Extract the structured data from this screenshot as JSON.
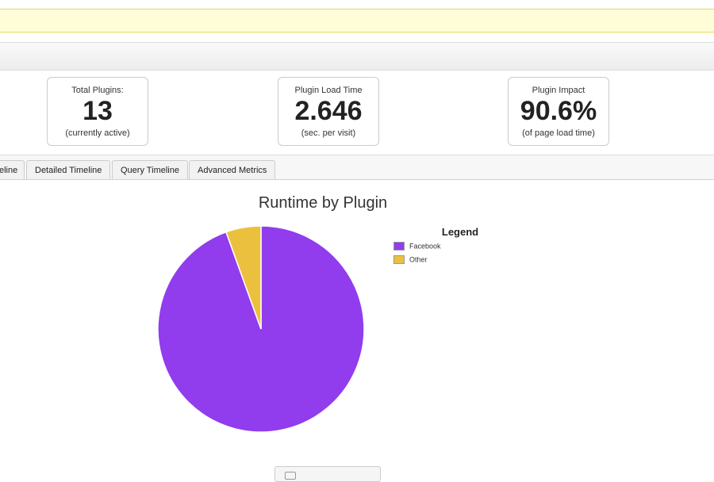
{
  "stats": [
    {
      "label": "Total Plugins:",
      "value": "13",
      "sub": "(currently active)"
    },
    {
      "label": "Plugin Load Time",
      "value": "2.646",
      "sub": "(sec. per visit)"
    },
    {
      "label": "Plugin Impact",
      "value": "90.6%",
      "sub": "(of page load time)"
    }
  ],
  "tabs": [
    "eline",
    "Detailed Timeline",
    "Query Timeline",
    "Advanced Metrics"
  ],
  "chart_data": {
    "type": "pie",
    "title": "Runtime by Plugin",
    "legend_title": "Legend",
    "legend_position": "right",
    "slices": [
      {
        "name": "Facebook",
        "value": 94.5,
        "color": "#913ced"
      },
      {
        "name": "Other",
        "value": 5.5,
        "color": "#ecc03f"
      }
    ]
  },
  "colors": {
    "notice_bg": "#fefdd8",
    "slice_border": "#ffffff"
  }
}
